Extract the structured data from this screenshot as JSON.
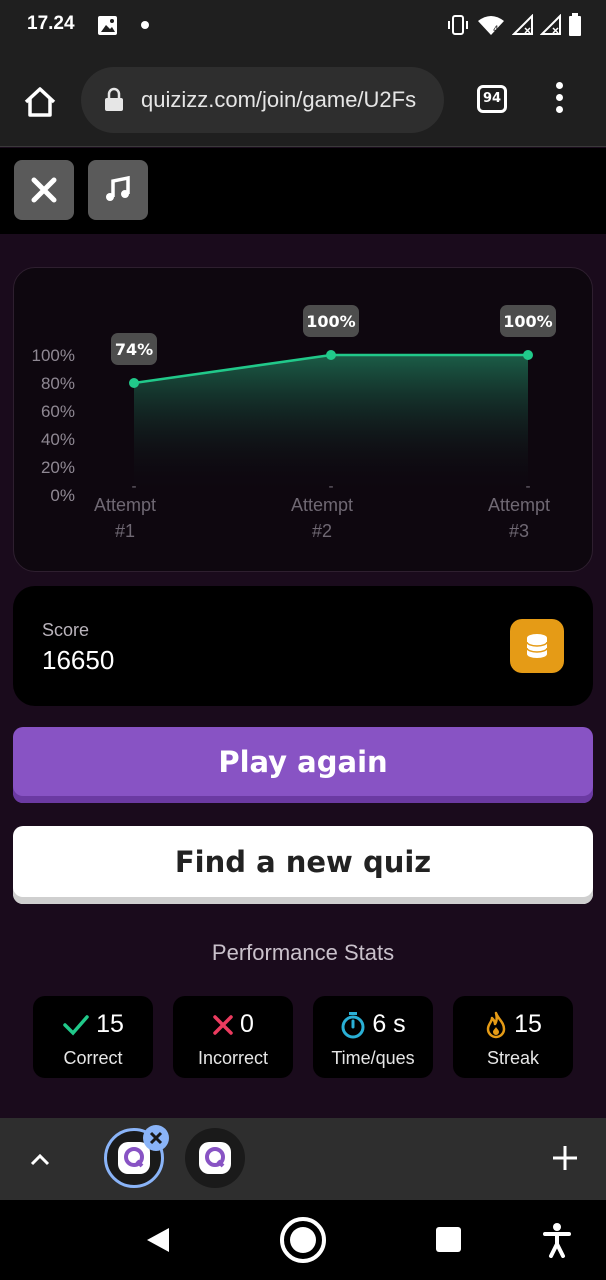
{
  "status_bar": {
    "time": "17.24",
    "icons": [
      "image-icon",
      "dot-icon",
      "vibrate-icon",
      "wifi-icon",
      "signal-icon",
      "signal-icon",
      "battery-icon"
    ]
  },
  "browser": {
    "url": "quizizz.com/join/game/U2Fs",
    "tab_count": "94",
    "icons": [
      "home-icon",
      "lock-icon",
      "tabs-icon",
      "more-vert-icon"
    ]
  },
  "quiz_toolbar": {
    "icons": [
      "close-icon",
      "music-note-icon"
    ]
  },
  "chart_data": {
    "type": "area",
    "categories": [
      [
        "Attempt",
        "#1"
      ],
      [
        "Attempt",
        "#2"
      ],
      [
        "Attempt",
        "#3"
      ]
    ],
    "values": [
      80,
      100,
      100
    ],
    "data_labels": [
      "74%",
      "100%",
      "100%"
    ],
    "y_ticks": [
      "0%",
      "20%",
      "40%",
      "60%",
      "80%",
      "100%"
    ],
    "ylim": [
      0,
      100
    ],
    "line_color": "#21c98a",
    "grid": false
  },
  "score": {
    "label": "Score",
    "value": "16650",
    "icon": "coins-icon",
    "icon_color": "#e59b16"
  },
  "actions": {
    "play_again": "Play again",
    "find_new_quiz": "Find a new quiz",
    "play_again_color": "#8853c4"
  },
  "performance": {
    "title": "Performance Stats",
    "stats": [
      {
        "icon": "check-icon",
        "value": "15",
        "label": "Correct",
        "color": "#21c98a"
      },
      {
        "icon": "x-icon",
        "value": "0",
        "label": "Incorrect",
        "color": "#ec3b5f"
      },
      {
        "icon": "timer-icon",
        "value": "6 s",
        "label": "Time/ques",
        "color": "#2ab0d6"
      },
      {
        "icon": "flame-icon",
        "value": "15",
        "label": "Streak",
        "color": "#e59b16"
      }
    ]
  },
  "tab_strip": {
    "icons": [
      "chevron-up-icon",
      "quizizz-tab-icon",
      "close-icon",
      "quizizz-tab-icon",
      "plus-icon"
    ]
  },
  "nav": {
    "icons": [
      "back-icon",
      "home-circle-icon",
      "recents-icon",
      "accessibility-icon"
    ]
  }
}
